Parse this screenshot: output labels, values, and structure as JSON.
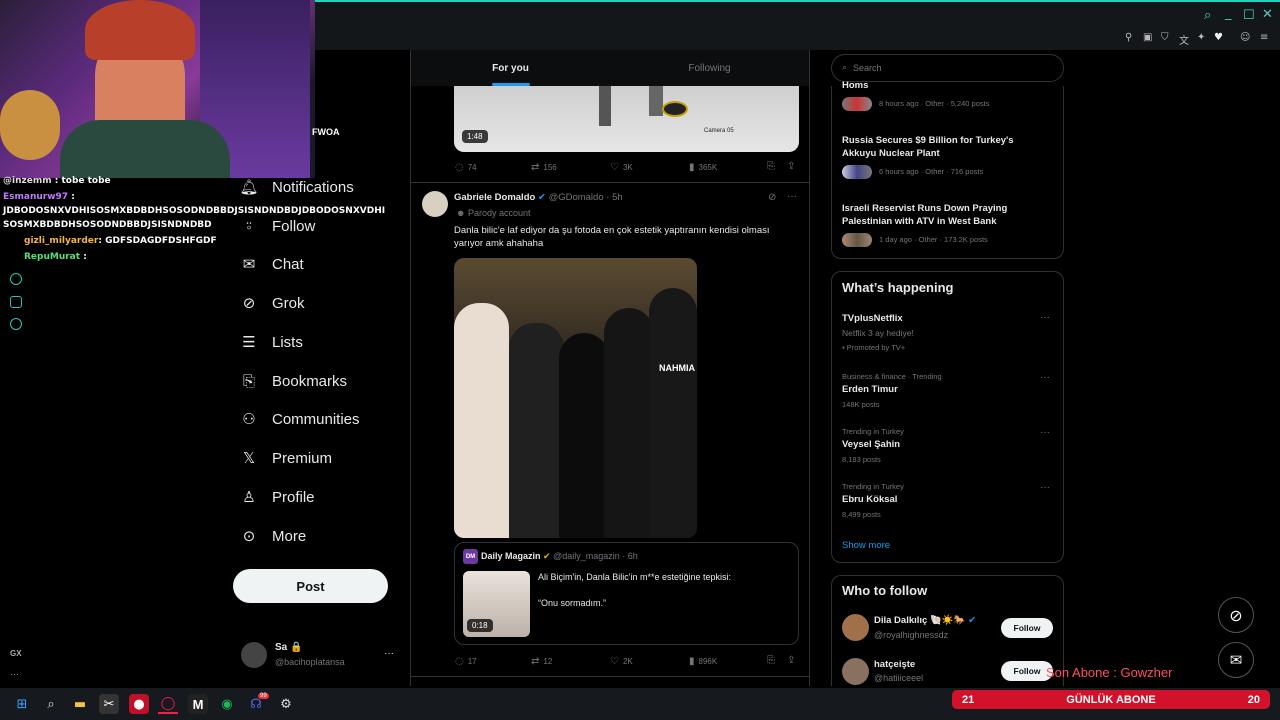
{
  "window": {
    "toolbar_icons": [
      "search-icon",
      "minimize-icon",
      "maximize-icon",
      "close-icon"
    ],
    "accent": "#1dd3c4"
  },
  "stream_chat": {
    "lines": [
      {
        "user": "@inzemm",
        "text": ": tobe tobe"
      },
      {
        "user": "Esmanurw97",
        "text": ":"
      },
      {
        "user": "",
        "text": "JDBODOSNXVDHISOSMXBDBDHSOSODNDBBDJSISNDNDBDJDBODOSNXVDHI"
      },
      {
        "user": "",
        "text": "SOSMXBDBDHSOSODNDBBDJSISNDNDBD"
      },
      {
        "user": "gizli_milyarder",
        "text": ": GDFSDAGDFDSHFGDF"
      },
      {
        "user": "RepuMurat",
        "text": ":"
      }
    ],
    "partial_text": "FWOA"
  },
  "nav": {
    "items": [
      {
        "label": "Notifications",
        "icon": "bell-icon"
      },
      {
        "label": "Follow",
        "icon": "add-person-icon"
      },
      {
        "label": "Chat",
        "icon": "mail-icon"
      },
      {
        "label": "Grok",
        "icon": "grok-icon"
      },
      {
        "label": "Lists",
        "icon": "list-icon"
      },
      {
        "label": "Bookmarks",
        "icon": "bookmark-icon"
      },
      {
        "label": "Communities",
        "icon": "communities-icon"
      },
      {
        "label": "Premium",
        "icon": "x-logo-icon"
      },
      {
        "label": "Profile",
        "icon": "profile-icon"
      },
      {
        "label": "More",
        "icon": "more-circle-icon"
      }
    ],
    "post_label": "Post",
    "account": {
      "name": "Sa 🔒",
      "handle": "@bacihoplatansa",
      "more": "···"
    }
  },
  "feed": {
    "tabs": [
      {
        "label": "For you",
        "active": true
      },
      {
        "label": "Following",
        "active": false
      }
    ],
    "video_tweet": {
      "duration": "1:48",
      "camera_label": "Camera 05",
      "actions": {
        "replies": "74",
        "reposts": "156",
        "likes": "3K",
        "views": "365K"
      }
    },
    "tweet": {
      "author": "Gabriele Domaldo",
      "handle": "@GDomaldo",
      "time": "· 5h",
      "parody": "Parody account",
      "text": "Danla bilic'e laf ediyor da şu fotoda en çok estetik yaptıranın kendisi olması yarıyor amk ahahaha",
      "photo_caption": "NAHMIA",
      "quote": {
        "avatar_label": "DM",
        "author": "Daily Magazin",
        "handle": "@daily_magazin",
        "time": "· 6h",
        "line1": "Ali Biçim'in, Danla Bilic'in m**e estetiğine tepkisi:",
        "line2": "“Onu sormadım.”",
        "duration": "0:18"
      },
      "actions": {
        "replies": "17",
        "reposts": "12",
        "likes": "2K",
        "views": "896K"
      }
    }
  },
  "sidebar": {
    "search_placeholder": "Search",
    "news": [
      {
        "title": "Homs",
        "meta": "8 hours ago · Other · 5,240 posts"
      },
      {
        "title": "Russia Secures $9 Billion for Turkey's Akkuyu Nuclear Plant",
        "title1": "Russia Secures $9 Billion for Turkey's",
        "title2": "Akkuyu Nuclear Plant",
        "meta": "6 hours ago · Other · 716 posts"
      },
      {
        "title1": "Israeli Reservist Runs Down Praying",
        "title2": "Palestinian with ATV in West Bank",
        "meta": "1 day ago · Other · 173.2K posts"
      }
    ],
    "whats_happening": {
      "heading": "What’s happening",
      "items": [
        {
          "meta": "",
          "name": "TVplusNetflix",
          "sub": "Netflix 3 ay hediye!",
          "promo": "Promoted by TV+"
        },
        {
          "meta": "Business & finance · Trending",
          "name": "Erden Timur",
          "count": "148K posts"
        },
        {
          "meta": "Trending in Turkey",
          "name": "Veysel Şahin",
          "count": "8,183 posts"
        },
        {
          "meta": "Trending in Turkey",
          "name": "Ebru Köksal",
          "count": "8,499 posts"
        }
      ],
      "show_more": "Show more"
    },
    "who_to_follow": {
      "heading": "Who to follow",
      "users": [
        {
          "name": "Dila Dalkılıç 🐚☀️🐎",
          "handle": "@royalhighnessdz",
          "follow": "Follow"
        },
        {
          "name": "hatçeişte",
          "handle": "@hatiiiceeel",
          "follow": "Follow"
        }
      ]
    }
  },
  "overlay": {
    "last_sub": "Son Abone : Gowzher",
    "sub_bar": {
      "left": "21",
      "label": "GÜNLÜK ABONE",
      "right": "20"
    },
    "sub_color": "#d1122a",
    "side_label": "GX"
  },
  "taskbar": {
    "apps": [
      "windows-start-icon",
      "search-icon",
      "file-explorer-icon",
      "snipping-icon",
      "red-app-icon",
      "opera-gx-icon",
      "mx-app-icon",
      "spotify-icon",
      "discord-icon",
      "steam-icon"
    ],
    "discord_badge": "99"
  }
}
